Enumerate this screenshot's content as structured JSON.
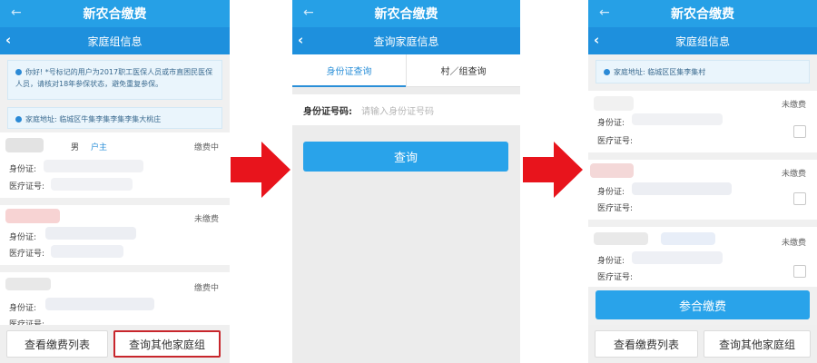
{
  "app_title": "新农合缴费",
  "screens": {
    "family_info": {
      "subtitle": "家庭组信息",
      "notice_text": "你好! *号标记的用户为2017职工医保人员或市直困民医保人员，请核对18年参保状态，避免重复参保。",
      "address_text": "家庭地址: 临城区牛集李集李集李集大桃庄",
      "members": [
        {
          "gender": "男",
          "role": "户主",
          "status": "缴费中",
          "id_label": "身份证:",
          "med_label": "医疗证号:"
        },
        {
          "status": "未缴费",
          "id_label": "身份证:",
          "med_label": "医疗证号:"
        },
        {
          "status": "缴费中",
          "id_label": "身份证:",
          "med_label": "医疗证号:"
        }
      ],
      "btn_list": "查看缴费列表",
      "btn_other": "查询其他家庭组"
    },
    "query_family": {
      "subtitle": "查询家庭信息",
      "tab_id": "身份证查询",
      "tab_village": "村／组查询",
      "id_label": "身份证号码:",
      "id_placeholder": "请输入身份证号码",
      "query_btn": "查询"
    },
    "family_result": {
      "subtitle": "家庭组信息",
      "address_text": "家庭地址: 临城区区集李集村",
      "members": [
        {
          "status": "未缴费",
          "id_label": "身份证:",
          "med_label": "医疗证号:"
        },
        {
          "status": "未缴费",
          "id_label": "身份证:",
          "med_label": "医疗证号:"
        },
        {
          "status": "未缴费",
          "id_label": "身份证:",
          "med_label": "医疗证号:"
        }
      ],
      "join_btn": "参合缴费",
      "btn_list": "查看缴费列表",
      "btn_other": "查询其他家庭组"
    }
  },
  "colors": {
    "appbar": "#26a0e6",
    "subbar": "#1e90dd",
    "primary_button": "#29a3ea",
    "arrow": "#e8141c",
    "highlight_box": "#c8262c"
  },
  "icons": [
    "back-arrow-icon",
    "chevron-left-icon",
    "info-dot-icon",
    "checkbox-icon",
    "red-arrow-icon"
  ]
}
